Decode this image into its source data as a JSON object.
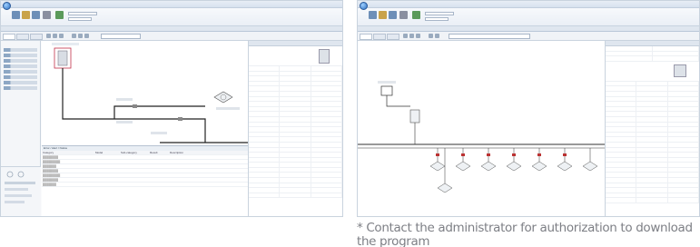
{
  "left_screenshot": {
    "error_panel": {
      "title": "Error / Alert / Notice",
      "columns": [
        "Category",
        "Model",
        "Sub-category",
        "Result",
        "Description"
      ]
    }
  },
  "right_screenshot": {},
  "footnote": "* Contact the administrator for authorization to download the program"
}
